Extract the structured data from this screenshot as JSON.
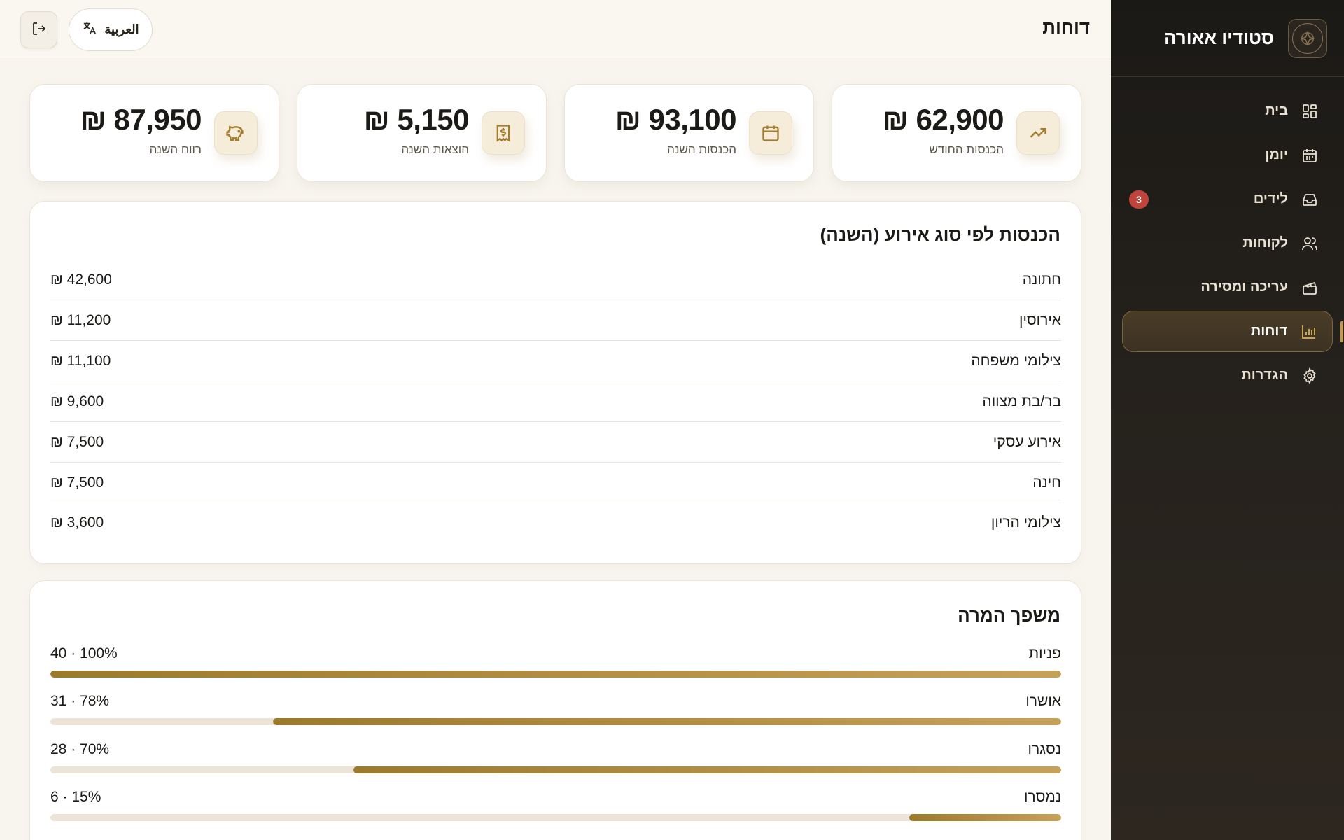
{
  "sidebar": {
    "brand_name": "סטודיו אאורה",
    "items": [
      {
        "label": "בית",
        "icon": "dashboard-icon"
      },
      {
        "label": "יומן",
        "icon": "calendar-icon"
      },
      {
        "label": "לידים",
        "icon": "inbox-icon",
        "badge": "3"
      },
      {
        "label": "לקוחות",
        "icon": "users-icon"
      },
      {
        "label": "עריכה ומסירה",
        "icon": "clapperboard-icon"
      },
      {
        "label": "דוחות",
        "icon": "bar-chart-icon",
        "active": true
      },
      {
        "label": "הגדרות",
        "icon": "gear-icon"
      }
    ]
  },
  "header": {
    "title": "דוחות",
    "language_button": "العربية"
  },
  "stats": [
    {
      "label": "הכנסות החודש",
      "value": "₪ 62,900",
      "icon": "trending-up-icon"
    },
    {
      "label": "הכנסות השנה",
      "value": "₪ 93,100",
      "icon": "calendar-icon"
    },
    {
      "label": "הוצאות השנה",
      "value": "₪ 5,150",
      "icon": "receipt-icon"
    },
    {
      "label": "רווח השנה",
      "value": "₪ 87,950",
      "icon": "piggy-bank-icon"
    }
  ],
  "revenue_by_type": {
    "title": "הכנסות לפי סוג אירוע (השנה)",
    "rows": [
      {
        "name": "חתונה",
        "amount": "₪ 42,600"
      },
      {
        "name": "אירוסין",
        "amount": "₪ 11,200"
      },
      {
        "name": "צילומי משפחה",
        "amount": "₪ 11,100"
      },
      {
        "name": "בר/בת מצווה",
        "amount": "₪ 9,600"
      },
      {
        "name": "אירוע עסקי",
        "amount": "₪ 7,500"
      },
      {
        "name": "חינה",
        "amount": "₪ 7,500"
      },
      {
        "name": "צילומי הריון",
        "amount": "₪ 3,600"
      }
    ]
  },
  "funnel": {
    "title": "משפך המרה",
    "rows": [
      {
        "label": "פניות",
        "meta": "40 · 100%",
        "percent": 100
      },
      {
        "label": "אושרו",
        "meta": "31 · 78%",
        "percent": 78
      },
      {
        "label": "נסגרו",
        "meta": "28 · 70%",
        "percent": 70
      },
      {
        "label": "נמסרו",
        "meta": "6 · 15%",
        "percent": 15
      }
    ]
  },
  "colors": {
    "accent_gold": "#b08a3e",
    "sidebar_bg": "#1f1c18",
    "badge_red": "#c0443c"
  }
}
